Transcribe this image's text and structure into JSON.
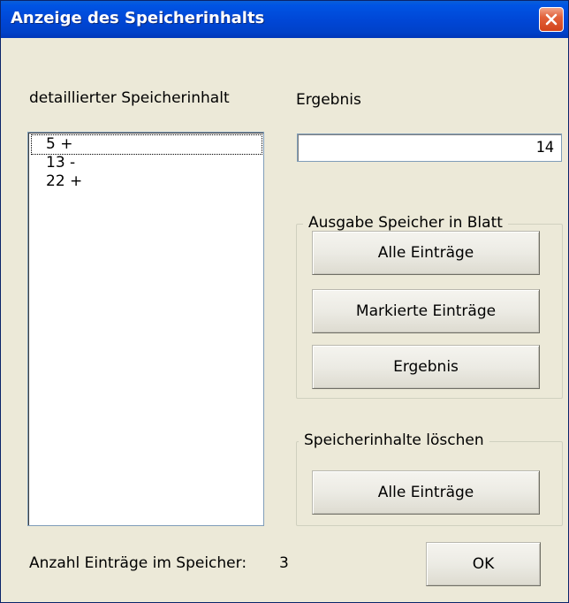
{
  "window": {
    "title": "Anzeige des Speicherinhalts"
  },
  "left": {
    "list_label": "detaillierter Speicherinhalt",
    "items": [
      {
        "text": "5 +"
      },
      {
        "text": "13 -"
      },
      {
        "text": "22 +"
      }
    ],
    "count_label": "Anzahl Einträge im Speicher:",
    "count_value": "3"
  },
  "right": {
    "result_label": "Ergebnis",
    "result_value": "14",
    "output_group": {
      "title": "Ausgabe Speicher in Blatt",
      "all_entries": "Alle Einträge",
      "marked_entries": "Markierte Einträge",
      "result": "Ergebnis"
    },
    "delete_group": {
      "title": "Speicherinhalte löschen",
      "all_entries": "Alle Einträge"
    },
    "ok_label": "OK"
  },
  "colors": {
    "titlebar": "#0054e3",
    "dialog_bg": "#ece9d8",
    "close_button": "#d2441b"
  }
}
